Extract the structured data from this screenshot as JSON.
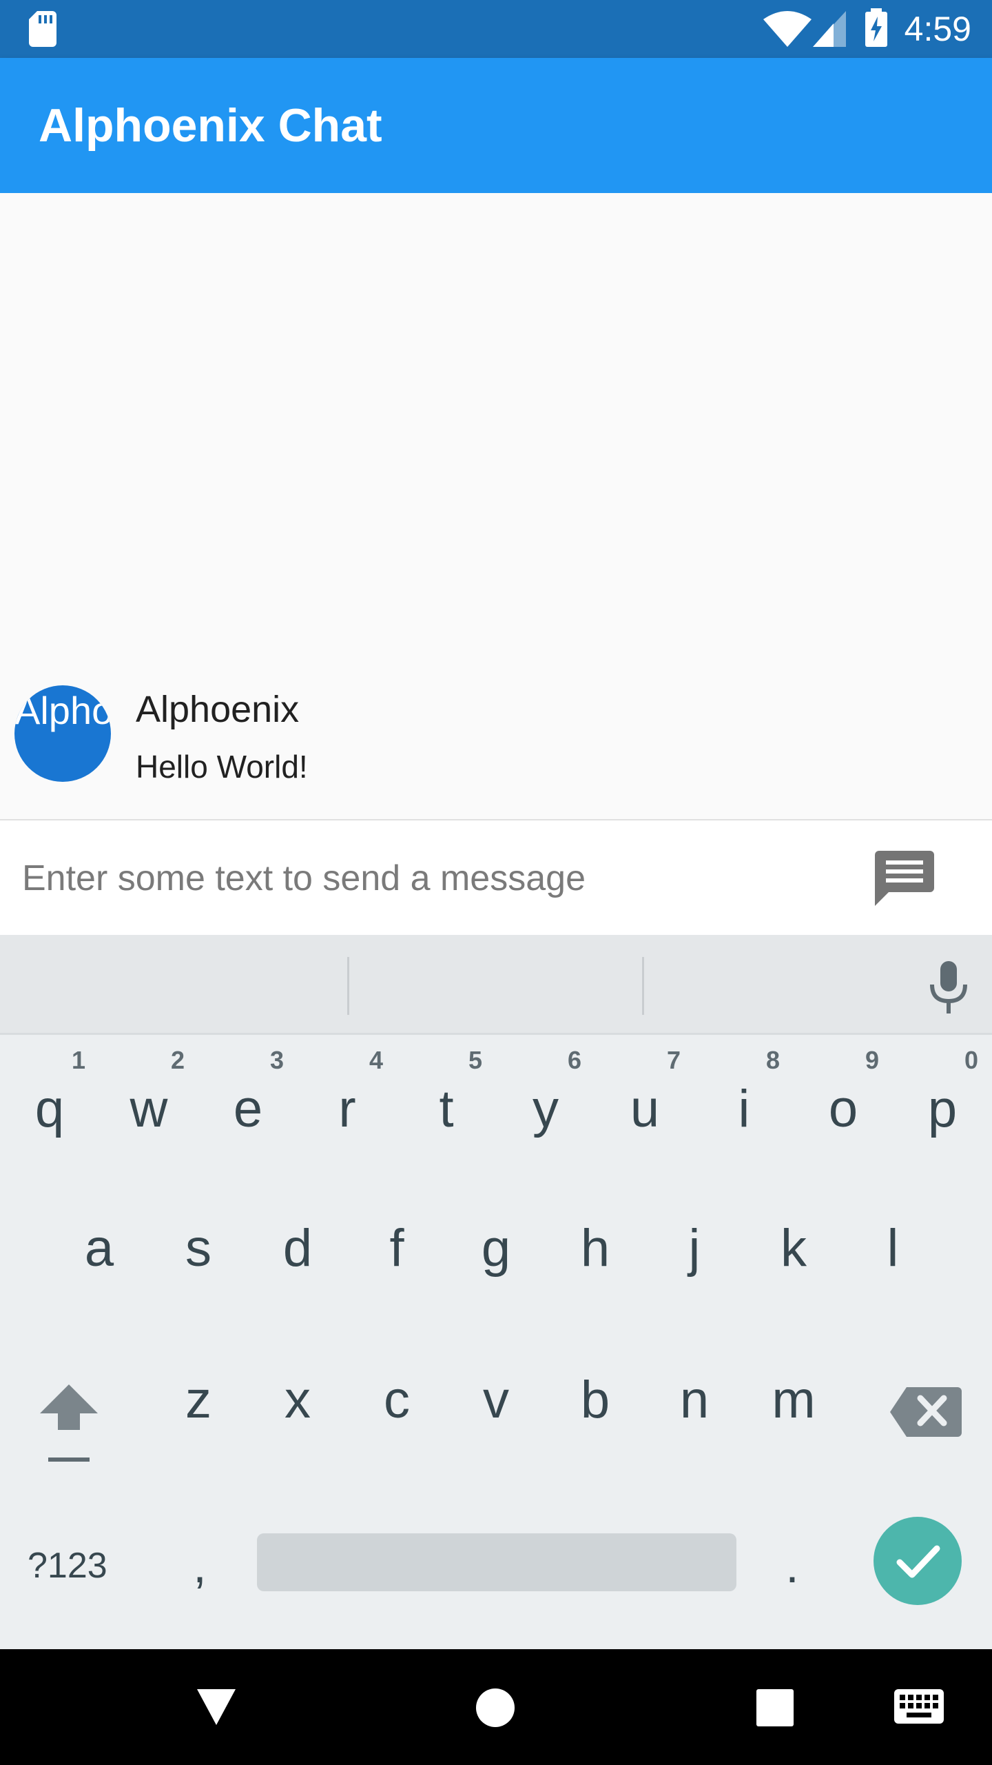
{
  "status_bar": {
    "time": "4:59"
  },
  "app_bar": {
    "title": "Alphoenix Chat"
  },
  "chat": {
    "messages": [
      {
        "avatar_text": "Alphoenix",
        "sender": "Alphoenix",
        "text": "Hello World!"
      }
    ]
  },
  "composer": {
    "placeholder": "Enter some text to send a message",
    "value": ""
  },
  "keyboard": {
    "row1": [
      {
        "char": "q",
        "num": "1"
      },
      {
        "char": "w",
        "num": "2"
      },
      {
        "char": "e",
        "num": "3"
      },
      {
        "char": "r",
        "num": "4"
      },
      {
        "char": "t",
        "num": "5"
      },
      {
        "char": "y",
        "num": "6"
      },
      {
        "char": "u",
        "num": "7"
      },
      {
        "char": "i",
        "num": "8"
      },
      {
        "char": "o",
        "num": "9"
      },
      {
        "char": "p",
        "num": "0"
      }
    ],
    "row2": [
      "a",
      "s",
      "d",
      "f",
      "g",
      "h",
      "j",
      "k",
      "l"
    ],
    "row3": [
      "z",
      "x",
      "c",
      "v",
      "b",
      "n",
      "m"
    ],
    "symbols_label": "?123",
    "comma": ",",
    "period": "."
  },
  "colors": {
    "status_bar": "#1b6fb6",
    "app_bar": "#2196f3",
    "avatar": "#1976d2",
    "done_key": "#4db6ac"
  }
}
